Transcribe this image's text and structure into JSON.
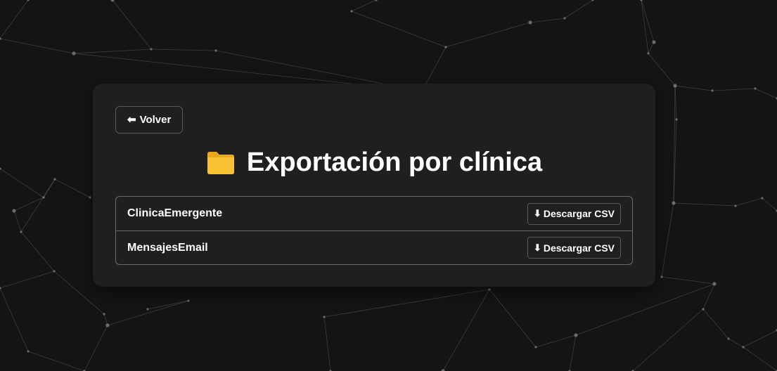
{
  "back_button": {
    "icon": "left-arrow-icon",
    "label": "Volver"
  },
  "header": {
    "icon": "folder-icon",
    "title": "Exportación por clínica"
  },
  "exports": [
    {
      "name": "ClinicaEmergente",
      "button_label": "Descargar CSV",
      "button_icon": "download-arrow-icon"
    },
    {
      "name": "MensajesEmail",
      "button_label": "Descargar CSV",
      "button_icon": "download-arrow-icon"
    }
  ],
  "colors": {
    "background": "#141414",
    "card": "#1f1f1f",
    "border": "#6a6a6a",
    "folder": "#f5bd2b",
    "network": "#8a8a8a"
  }
}
